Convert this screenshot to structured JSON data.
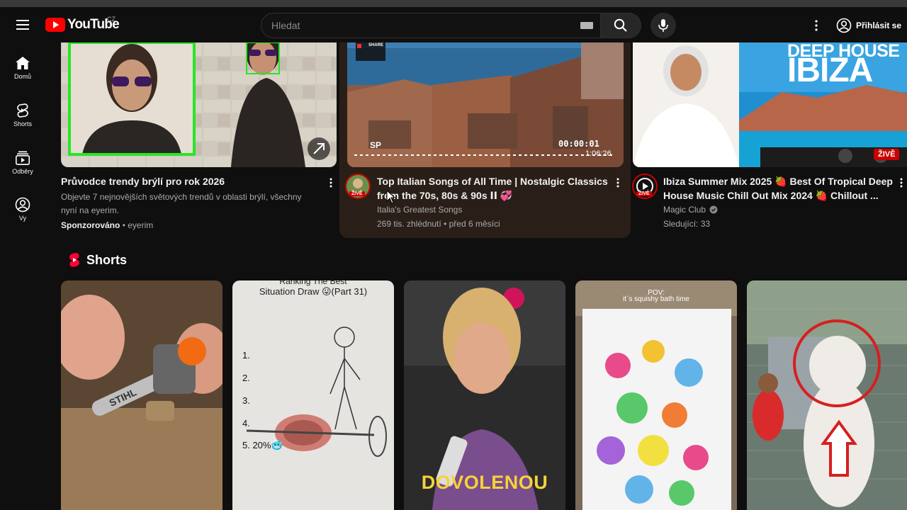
{
  "header": {
    "logo_text": "YouTube",
    "country_code": "CZ",
    "search_placeholder": "Hledat",
    "signin_label": "Přihlásit se"
  },
  "sidebar": {
    "items": [
      {
        "label": "Domů",
        "icon": "home-icon"
      },
      {
        "label": "Shorts",
        "icon": "shorts-icon"
      },
      {
        "label": "Odběry",
        "icon": "subscriptions-icon"
      },
      {
        "label": "Vy",
        "icon": "account-icon"
      }
    ]
  },
  "videos": [
    {
      "title": "Průvodce trendy brýlí pro rok 2026",
      "desc_line1": "Objevte 7 nejnovějších světových trendů v oblasti brýlí, všechny",
      "desc_line2": "nyní na eyerim.",
      "sponsored": "Sponzorováno",
      "advertiser": "eyerim"
    },
    {
      "title_line1": "Top Italian Songs of All Time | Nostalgic Classics",
      "title_line2": "from the 70s, 80s & 90s ⅠⅠ 💞",
      "channel": "Italia's Greatest Songs",
      "meta": "269 tis. zhlédnutí • před 6 měsíci",
      "timer": "00:00:01",
      "duration": "1:06:26",
      "share_label": "SHARE",
      "sp_label": "SP",
      "live_badge": "ŽIVĚ"
    },
    {
      "title_line1": "Ibiza Summer Mix 2025 🍓 Best Of Tropical Deep",
      "title_line2": "House Music Chill Out Mix 2024 🍓 Chillout ...",
      "channel": "Magic Club",
      "meta": "Sledující: 33",
      "thumb_text1": "DEEP HOUSE",
      "thumb_text2": "IBIZA",
      "live_badge": "ŽIVĚ",
      "avatar_live": "ŽIVĚ"
    }
  ],
  "shorts": {
    "title": "Shorts",
    "items": [
      {
        "overlay": "STIHL"
      },
      {
        "overlay_title1": "Ranking The Best",
        "overlay_title2": "Situation Draw 😛(Part 31)",
        "list": [
          "1.",
          "2.",
          "3.",
          "4.",
          "5. 20%🥶"
        ]
      },
      {
        "overlay": "DOVOLENOU"
      },
      {
        "overlay1": "POV:",
        "overlay2": "it`s squishy bath time"
      },
      {
        "overlay": ""
      }
    ]
  },
  "colors": {
    "background": "#0f0f0f",
    "youtube_red": "#ff0000",
    "live_red": "#cc0000",
    "text_primary": "#f1f1f1",
    "text_secondary": "#aaaaaa"
  }
}
